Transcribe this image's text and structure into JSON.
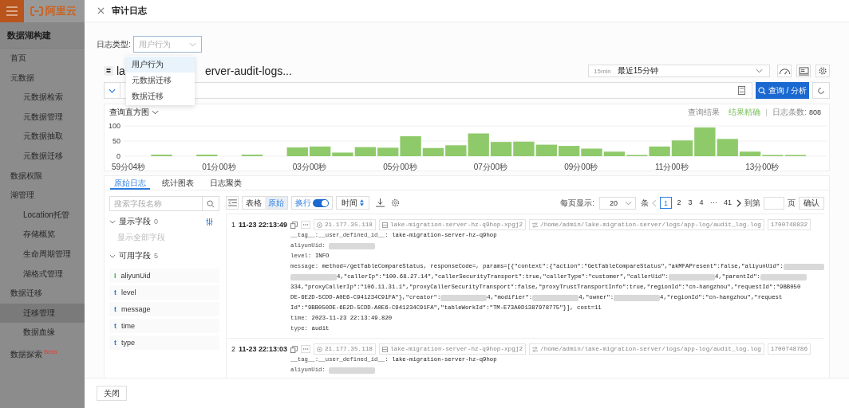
{
  "sidebar": {
    "logo": "阿里云",
    "title": "数据湖构建",
    "items": [
      {
        "label": "首页",
        "selected": false
      },
      {
        "label": "元数据",
        "children": [
          {
            "label": "元数据检索",
            "selected": false
          },
          {
            "label": "元数据管理",
            "selected": false
          },
          {
            "label": "元数据抽取",
            "selected": false
          },
          {
            "label": "元数据迁移",
            "selected": false
          }
        ]
      },
      {
        "label": "数据权限",
        "selected": false
      },
      {
        "label": "湖管理",
        "children": [
          {
            "label": "Location托管",
            "selected": false
          },
          {
            "label": "存储概览",
            "selected": false
          },
          {
            "label": "生命周期管理",
            "selected": false
          },
          {
            "label": "湖格式管理",
            "selected": false
          }
        ]
      },
      {
        "label": "数据迁移",
        "children": [
          {
            "label": "迁移管理",
            "selected": true
          },
          {
            "label": "数据血缘",
            "selected": false
          }
        ]
      },
      {
        "label": "数据探索",
        "badge": "Beta",
        "selected": false
      }
    ]
  },
  "drawer": {
    "title": "审计日志"
  },
  "log_type": {
    "label": "日志类型:",
    "value": "用户行为",
    "options": [
      {
        "label": "用户行为",
        "selected": true
      },
      {
        "label": "元数据迁移",
        "selected": false
      },
      {
        "label": "数据迁移",
        "selected": false
      }
    ]
  },
  "logstore": {
    "title_parts": [
      "la",
      "erver-audit-logs..."
    ]
  },
  "time_range": {
    "short": "15min",
    "label": "最近15分钟"
  },
  "query": {
    "button": "查询 / 分析"
  },
  "histogram": {
    "title": "查询直方图",
    "result_label": "查询结果",
    "result_status": "结果精确",
    "count_label": "日志条数:",
    "count": "808",
    "chart_data": {
      "type": "bar",
      "categories": [
        "59分04秒",
        null,
        null,
        null,
        "01分00秒",
        null,
        null,
        null,
        "03分00秒",
        null,
        null,
        null,
        "05分00秒",
        null,
        null,
        null,
        "07分00秒",
        null,
        null,
        null,
        "09分00秒",
        null,
        null,
        null,
        "11分00秒",
        null,
        null,
        null,
        "13分00秒",
        null
      ],
      "series": [
        {
          "color": "#8fca6a",
          "values": [
            0,
            5,
            0,
            5,
            0,
            5,
            0,
            29,
            32,
            12,
            30,
            28,
            66,
            27,
            36,
            75,
            47,
            48,
            38,
            34,
            25,
            15,
            4,
            32,
            52,
            95,
            57,
            15,
            4,
            4
          ]
        }
      ],
      "ylim": [
        0,
        100
      ],
      "yticks": [
        0,
        50,
        100
      ]
    }
  },
  "log_tabs": [
    {
      "label": "原始日志",
      "selected": true
    },
    {
      "label": "统计图表",
      "selected": false
    },
    {
      "label": "日志聚类",
      "selected": false
    }
  ],
  "fields": {
    "search_placeholder": "搜索字段名称",
    "shown": {
      "label": "显示字段",
      "count": "0",
      "expanded": true
    },
    "show_all": "显示全部字段",
    "available": {
      "label": "可用字段",
      "count": "5",
      "expanded": true
    },
    "items": [
      {
        "type": "I",
        "name": "aliyunUid",
        "kind": "number"
      },
      {
        "type": "t",
        "name": "level",
        "kind": "text"
      },
      {
        "type": "t",
        "name": "message",
        "kind": "text"
      },
      {
        "type": "t",
        "name": "time",
        "kind": "text"
      },
      {
        "type": "t",
        "name": "type",
        "kind": "text"
      }
    ]
  },
  "toolbar": {
    "views": [
      {
        "label": "表格",
        "selected": false
      },
      {
        "label": "原始",
        "selected": true
      }
    ],
    "wrap": {
      "label": "换行",
      "on": true
    },
    "sort": {
      "label": "时间"
    }
  },
  "pagination": {
    "per_page_label": "每页显示:",
    "per_page": "20",
    "unit": "条",
    "prev_disabled": true,
    "pages": [
      {
        "label": "1",
        "selected": true
      },
      {
        "label": "2",
        "selected": false
      },
      {
        "label": "3",
        "selected": false
      },
      {
        "label": "4",
        "selected": false
      },
      {
        "label": "···",
        "selected": false
      },
      {
        "label": "41",
        "selected": false
      }
    ],
    "goto_label": "到第",
    "page_unit": "页",
    "confirm": "确认"
  },
  "logs": [
    {
      "index": "1",
      "time": "11-23 22:13:49",
      "ip": "21.177.35.118",
      "host": "lake-migration-server-hz-q9hop-xpgj2",
      "path": "/home/admin/lake-migration-server/logs/app-log/audit_log.log",
      "stamp": "1700748832",
      "fields": [
        {
          "key": "__tag__:__user_defined_id__:",
          "lines": [
            [
              {
                "text": "lake-migration-server-hz-q9hop"
              }
            ]
          ]
        },
        {
          "key": "aliyunUid:",
          "lines": [
            [
              {
                "kind": "redacted"
              }
            ]
          ]
        },
        {
          "key": "level:",
          "lines": [
            [
              {
                "text": "INFO"
              }
            ]
          ]
        },
        {
          "key": "message:",
          "lines": [
            [
              {
                "text": "method=/getTableCompareStatus, responseCode=, params=[{\"context\":{\"action\":\"GetTableCompareStatus\",\"akMFAPresent\":false,\"aliyunUid\":"
              },
              {
                "kind": "redacted"
              }
            ],
            [
              {
                "kind": "redacted"
              },
              {
                "text": "4,\"callerIp\":\"100.68.27.14\",\"callerSecurityTransport\":true,\"callerType\":\"customer\",\"callerUid\":"
              },
              {
                "kind": "redacted"
              },
              {
                "text": "4,\"parentId\":"
              },
              {
                "kind": "redacted"
              }
            ],
            [
              {
                "text": "334,\"proxyCallerIp\":\"106.11.31.1\",\"proxyCallerSecurityTransport\":false,\"proxyTrustTransportInfo\":true,\"regionId\":\"cn-hangzhou\",\"requestId\":\"9BB050"
              }
            ],
            [
              {
                "text": "DE-6E2D-5CDD-A0E6-C941234C91FA\"},\"creator\":"
              },
              {
                "kind": "redacted"
              },
              {
                "text": "4,\"modifier\":"
              },
              {
                "kind": "redacted"
              },
              {
                "text": "4,\"owner\":"
              },
              {
                "kind": "redacted"
              },
              {
                "text": "4,\"regionId\":\"cn-hangzhou\",\"request"
              }
            ],
            [
              {
                "text": "Id\":\"9BB050DE-6E2D-5CDD-A0E6-C941234C91FA\",\"tableWorkId\":\"TM-E73A0D1387978775\"}], cost=11"
              }
            ]
          ]
        },
        {
          "key": "time:",
          "lines": [
            [
              {
                "text": "2023-11-23 22:13:49.820"
              }
            ]
          ]
        },
        {
          "key": "type:",
          "lines": [
            [
              {
                "text": "audit"
              }
            ]
          ]
        }
      ]
    },
    {
      "index": "2",
      "time": "11-23 22:13:03",
      "ip": "21.177.35.118",
      "host": "lake-migration-server-hz-q9hop-xpgj2",
      "path": "/home/admin/lake-migration-server/logs/app-log/audit_log.log",
      "stamp": "1700748786",
      "fields": [
        {
          "key": "__tag__:__user_defined_id__:",
          "lines": [
            [
              {
                "text": "lake-migration-server-hz-q9hop"
              }
            ]
          ]
        },
        {
          "key": "aliyunUid:",
          "lines": [
            [
              {
                "kind": "redacted"
              }
            ]
          ]
        }
      ]
    }
  ],
  "footer": {
    "close": "关闭"
  }
}
